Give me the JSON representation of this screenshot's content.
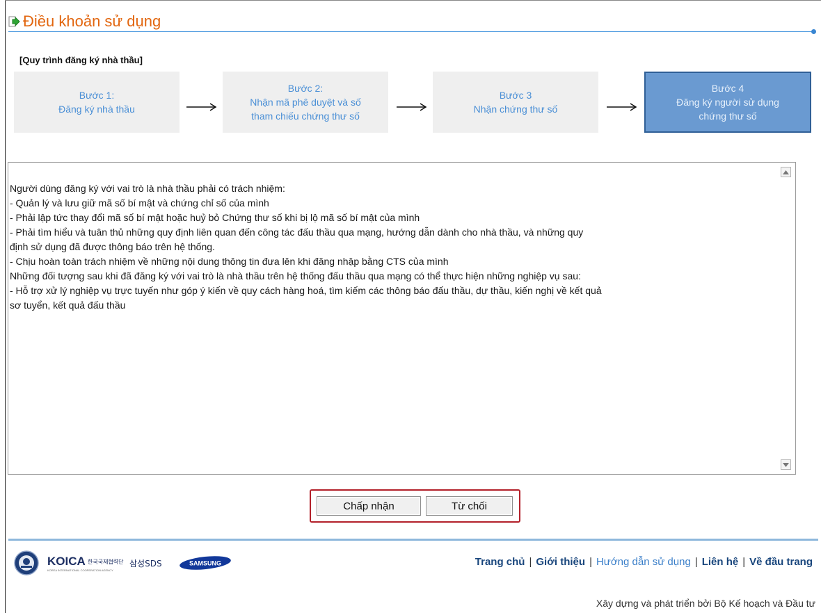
{
  "header": {
    "title": "Điều khoản sử dụng"
  },
  "process": {
    "title": "[Quy trình đăng ký nhà thầu]",
    "steps": [
      {
        "line1": "Bước 1:",
        "line2": "Đăng ký nhà thầu",
        "line3": ""
      },
      {
        "line1": "Bước 2:",
        "line2": "Nhận mã phê duyệt và số",
        "line3": "tham chiếu chứng thư số"
      },
      {
        "line1": "Bước 3",
        "line2": "Nhận chứng thư số",
        "line3": ""
      },
      {
        "line1": "Bước 4",
        "line2": "Đăng ký người sử dụng",
        "line3": "chứng thư số"
      }
    ],
    "active_step": 4
  },
  "terms": {
    "lines": [
      "Người dùng đăng ký với vai trò là nhà thầu phải có trách nhiệm:",
      "- Quản lý và lưu giữ mã số bí mật và chứng chỉ số của mình",
      "- Phải lập tức thay đổi mã số bí mật hoặc huỷ bỏ Chứng thư số khi bị lộ mã số bí mật của mình",
      "- Phải tìm hiểu và tuân thủ những  quy định liên quan đến công tác đấu thầu qua mạng, hướng dẫn dành cho nhà thầu, và những quy",
      "định sử dụng đã được thông báo trên hệ thống.",
      "- Chịu hoàn toàn trách nhiệm về những nội dung thông tin đưa lên khi đăng nhập bằng CTS của mình",
      "Những đối tượng sau khi đã đăng ký với vai trò là nhà thầu trên hệ thống đấu thầu qua mạng có thể thực hiện những nghiệp vụ sau:",
      "- Hỗ trợ xử lý nghiệp vụ trực tuyến như góp ý kiến về quy cách hàng hoá, tìm kiếm các thông báo đấu thầu, dự thầu, kiến nghị về kết quả",
      "sơ tuyển, kết quả đấu thầu"
    ]
  },
  "actions": {
    "accept_label": "Chấp nhận",
    "reject_label": "Từ chối"
  },
  "footer": {
    "logos": {
      "koica": "KOICA",
      "koica_sub": "KOREA INTERNATIONAL COOPERATION AGENCY",
      "korean": "한국국제협력단",
      "samsungsds": "삼성SDS",
      "samsung": "SAMSUNG"
    },
    "links": [
      "Trang chủ",
      "Giới thiệu",
      "Hướng dẫn sử dụng",
      "Liên hệ",
      "Về đầu trang"
    ],
    "credit": "Xây dựng và phát triển bởi Bộ Kế hoạch và Đầu tư"
  },
  "colors": {
    "accent_orange": "#e2660f",
    "step_text": "#4a8fd6",
    "active_step_bg": "#6a9ad1",
    "highlight_border": "#b3202a"
  }
}
